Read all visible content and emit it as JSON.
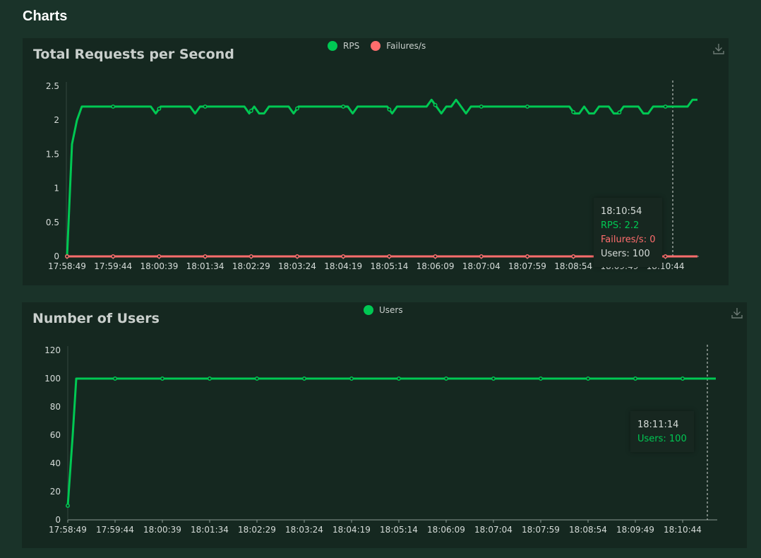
{
  "page": {
    "title": "Charts"
  },
  "colors": {
    "rps": "#00c853",
    "failures": "#ff6d6d",
    "users": "#00c853"
  },
  "chart_data": [
    {
      "type": "line",
      "title": "Total Requests per Second",
      "ylim": [
        0,
        2.5
      ],
      "yticks": [
        "0",
        "0.5",
        "1",
        "1.5",
        "2",
        "2.5"
      ],
      "xticks": [
        "17:58:49",
        "17:59:44",
        "18:00:39",
        "18:01:34",
        "18:02:29",
        "18:03:24",
        "18:04:19",
        "18:05:14",
        "18:06:09",
        "18:07:04",
        "18:07:59",
        "18:08:54",
        "18:09:49",
        "18:10:44"
      ],
      "legend": [
        "RPS",
        "Failures/s"
      ],
      "series": [
        {
          "name": "RPS",
          "color": "#00c853",
          "values": [
            0,
            1.65,
            2.0,
            2.2,
            2.2,
            2.2,
            2.2,
            2.2,
            2.2,
            2.2,
            2.2,
            2.2,
            2.2,
            2.2,
            2.2,
            2.2,
            2.2,
            2.2,
            2.1,
            2.2,
            2.2,
            2.2,
            2.2,
            2.2,
            2.2,
            2.2,
            2.1,
            2.2,
            2.2,
            2.2,
            2.2,
            2.2,
            2.2,
            2.2,
            2.2,
            2.2,
            2.2,
            2.1,
            2.2,
            2.1,
            2.1,
            2.2,
            2.2,
            2.2,
            2.2,
            2.2,
            2.1,
            2.2,
            2.2,
            2.2,
            2.2,
            2.2,
            2.2,
            2.2,
            2.2,
            2.2,
            2.2,
            2.2,
            2.1,
            2.2,
            2.2,
            2.2,
            2.2,
            2.2,
            2.2,
            2.2,
            2.1,
            2.2,
            2.2,
            2.2,
            2.2,
            2.2,
            2.2,
            2.2,
            2.3,
            2.2,
            2.1,
            2.2,
            2.2,
            2.3,
            2.2,
            2.1,
            2.2,
            2.2,
            2.2,
            2.2,
            2.2,
            2.2,
            2.2,
            2.2,
            2.2,
            2.2,
            2.2,
            2.2,
            2.2,
            2.2,
            2.2,
            2.2,
            2.2,
            2.2,
            2.2,
            2.2,
            2.2,
            2.1,
            2.1,
            2.2,
            2.1,
            2.1,
            2.2,
            2.2,
            2.2,
            2.1,
            2.1,
            2.2,
            2.2,
            2.2,
            2.2,
            2.1,
            2.1,
            2.2,
            2.2,
            2.2,
            2.2,
            2.2,
            2.2,
            2.2,
            2.2,
            2.3,
            2.3
          ]
        },
        {
          "name": "Failures/s",
          "color": "#ff6d6d",
          "constant": 0
        }
      ],
      "tooltip": {
        "time": "18:10:54",
        "rps": "RPS: 2.2",
        "failures": "Failures/s: 0",
        "users": "Users: 100"
      }
    },
    {
      "type": "line",
      "title": "Number of Users",
      "ylim": [
        0,
        120
      ],
      "yticks": [
        "0",
        "20",
        "40",
        "60",
        "80",
        "100",
        "120"
      ],
      "xticks": [
        "17:58:49",
        "17:59:44",
        "18:00:39",
        "18:01:34",
        "18:02:29",
        "18:03:24",
        "18:04:19",
        "18:05:14",
        "18:06:09",
        "18:07:04",
        "18:07:59",
        "18:08:54",
        "18:09:49",
        "18:10:44"
      ],
      "legend": [
        "Users"
      ],
      "series": [
        {
          "name": "Users",
          "color": "#00c853",
          "values": [
            10,
            60,
            100,
            100
          ]
        }
      ],
      "tooltip": {
        "time": "18:11:14",
        "users": "Users: 100"
      }
    }
  ]
}
